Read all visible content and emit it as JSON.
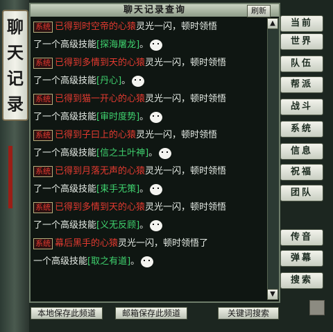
{
  "window": {
    "title": "聊天记录查询",
    "refresh_label": "刷新",
    "side_title": [
      "聊",
      "天",
      "记",
      "录"
    ]
  },
  "messages": [
    {
      "tag": "系统",
      "prefix": "已得到时空帝的",
      "mind": "心猿",
      "mid": "灵光一闪，顿时领悟",
      "line2": "了一个高级技能",
      "skill": "[探海屠龙]",
      "end": "。"
    },
    {
      "tag": "系统",
      "prefix": "已得到多情到天的",
      "mind": "心猿",
      "mid": "灵光一闪，顿时领悟",
      "line2": "了一个高级技能",
      "skill": "[丹心]",
      "end": "。"
    },
    {
      "tag": "系统",
      "prefix": "已得到猫一开心的",
      "mind": "心猿",
      "mid": "灵光一闪，顿时领悟",
      "line2": "了一个高级技能",
      "skill": "[审时度势]",
      "end": "。"
    },
    {
      "tag": "系统",
      "prefix": "已得到子曰上的",
      "mind": "心猿",
      "mid": "灵光一闪，顿时领悟",
      "line2": "了一个高级技能",
      "skill": "[信之土叶神]",
      "end": "。"
    },
    {
      "tag": "系统",
      "prefix": "已得到月落无声的",
      "mind": "心猿",
      "mid": "灵光一闪，顿时领悟",
      "line2": "了一个高级技能",
      "skill": "[束手无策]",
      "end": "。"
    },
    {
      "tag": "系统",
      "prefix": "已得到多情到天的",
      "mind": "心猿",
      "mid": "灵光一闪，顿时领悟",
      "line2": "了一个高级技能",
      "skill": "[义无反顾]",
      "end": "。"
    },
    {
      "tag": "系统",
      "prefix": "幕后黑手的",
      "mind": "心猿",
      "mid": "灵光一闪，顿时领悟了",
      "line2": "一个高级技能",
      "skill": "[取之有道]",
      "end": "。"
    }
  ],
  "side_buttons": [
    "当前",
    "世界",
    "队伍",
    "帮派",
    "战斗",
    "系统",
    "信息",
    "祝福",
    "团队",
    "传音",
    "弹幕",
    "搜索"
  ],
  "bottom_buttons": {
    "save_local": "本地保存此频道",
    "save_mail": "邮箱保存此频道",
    "keyword_search": "关键词搜索"
  },
  "icons": {
    "scroll_up": "up-arrow-icon",
    "scroll_down": "down-arrow-icon",
    "emote": "smiley-icon"
  }
}
